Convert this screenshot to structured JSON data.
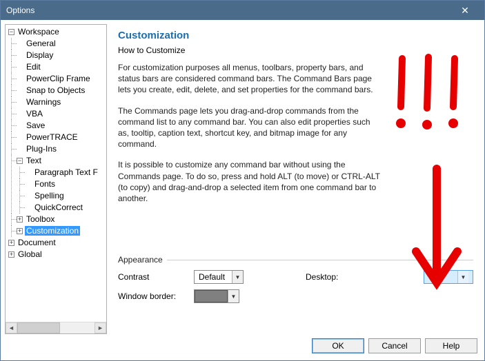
{
  "window": {
    "title": "Options"
  },
  "tree": {
    "workspace": "Workspace",
    "children": {
      "general": "General",
      "display": "Display",
      "edit": "Edit",
      "powerclip": "PowerClip Frame",
      "snap": "Snap to Objects",
      "warnings": "Warnings",
      "vba": "VBA",
      "save": "Save",
      "powertrace": "PowerTRACE",
      "plugins": "Plug-Ins",
      "text": "Text",
      "text_children": {
        "paragraph": "Paragraph Text F",
        "fonts": "Fonts",
        "spelling": "Spelling",
        "quickcorrect": "QuickCorrect"
      },
      "toolbox": "Toolbox",
      "customization": "Customization"
    },
    "document": "Document",
    "global": "Global"
  },
  "main": {
    "heading": "Customization",
    "subhead": "How to Customize",
    "para1": "For customization purposes all menus, toolbars, property bars, and status bars are considered command bars. The Command Bars page lets you create, edit, delete, and set properties for the command bars.",
    "para2": "The Commands page lets you drag-and-drop commands from the command list to any command bar. You can also edit properties such as, tooltip, caption text, shortcut key, and bitmap image for any command.",
    "para3": "It is possible to customize any command bar without using the Commands page. To do so, press and hold ALT (to move) or CTRL-ALT (to copy) and drag-and-drop a selected item from one command bar to another."
  },
  "appearance": {
    "section": "Appearance",
    "contrast_label": "Contrast",
    "contrast_value": "Default",
    "desktop_label": "Desktop:",
    "desktop_value": "",
    "border_label": "Window border:"
  },
  "buttons": {
    "ok": "OK",
    "cancel": "Cancel",
    "help": "Help"
  }
}
